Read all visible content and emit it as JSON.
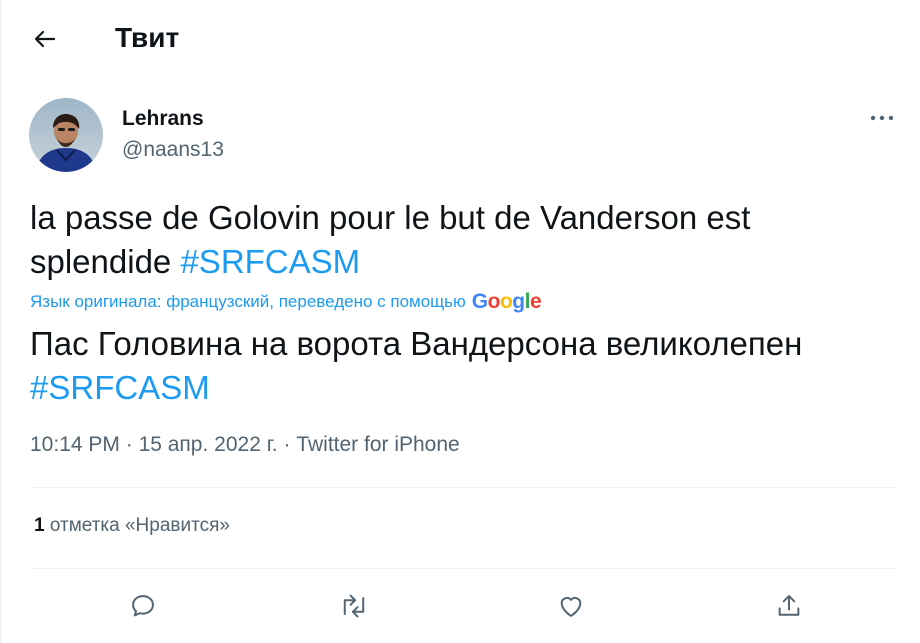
{
  "header": {
    "title": "Твит"
  },
  "author": {
    "name": "Lehrans",
    "handle": "@naans13"
  },
  "tweet": {
    "text_prefix": "la passe de Golovin pour le but de Vanderson est splendide ",
    "hashtag": "#SRFCASM",
    "translation_note": "Язык оригинала: французский, переведено с помощью",
    "translated_prefix": "Пас Головина на ворота Вандерсона великолепен",
    "translated_hashtag": "#SRFCASM",
    "google_logo": [
      "G",
      "o",
      "o",
      "g",
      "l",
      "e"
    ]
  },
  "meta": {
    "time": "10:14 PM",
    "sep1": " · ",
    "date": "15 апр. 2022 г.",
    "sep2": " · ",
    "source": "Twitter for iPhone"
  },
  "stats": {
    "likes_count": "1",
    "likes_label": " отметка «Нравится»"
  },
  "actions": [
    "reply-icon",
    "retweet-icon",
    "like-icon",
    "share-icon"
  ],
  "colors": {
    "accent": "#1d9bf0",
    "text": "#0f1419",
    "secondary": "#536471",
    "google": [
      "#4285f4",
      "#ea4335",
      "#fbbc05",
      "#4285f4",
      "#34a853",
      "#ea4335"
    ]
  }
}
